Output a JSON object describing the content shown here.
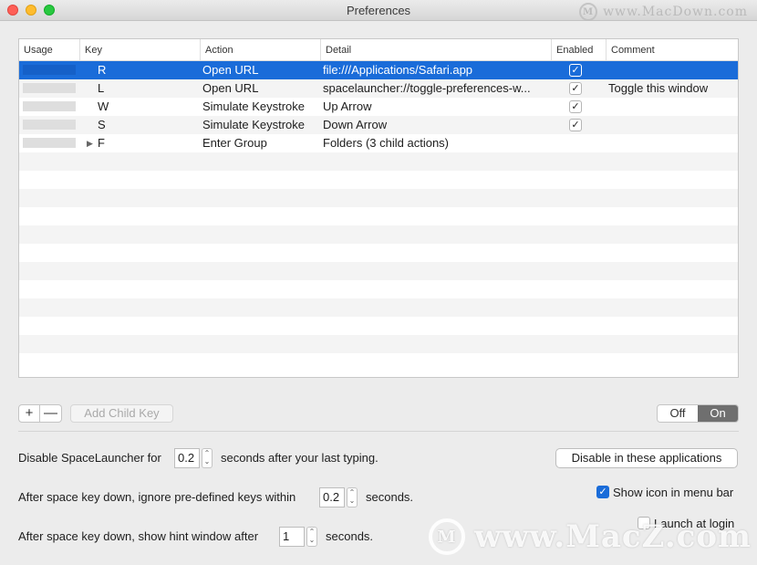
{
  "window": {
    "title": "Preferences",
    "watermark_top": "www.MacDown.com",
    "watermark_top_logo": "M",
    "watermark_bottom": "www.MacZ.com",
    "watermark_bottom_logo": "M"
  },
  "table": {
    "columns": [
      "Usage",
      "Key",
      "Action",
      "Detail",
      "Enabled",
      "Comment"
    ],
    "rows": [
      {
        "key": "R",
        "action": "Open URL",
        "detail": "file:///Applications/Safari.app",
        "enabled": true,
        "comment": "",
        "selected": true,
        "expandable": false
      },
      {
        "key": "L",
        "action": "Open URL",
        "detail": "spacelauncher://toggle-preferences-w...",
        "enabled": true,
        "comment": "Toggle this window",
        "selected": false,
        "expandable": false
      },
      {
        "key": "W",
        "action": "Simulate Keystroke",
        "detail": "Up Arrow",
        "enabled": true,
        "comment": "",
        "selected": false,
        "expandable": false
      },
      {
        "key": "S",
        "action": "Simulate Keystroke",
        "detail": "Down Arrow",
        "enabled": true,
        "comment": "",
        "selected": false,
        "expandable": false
      },
      {
        "key": "F",
        "action": "Enter Group",
        "detail": "Folders (3 child actions)",
        "enabled": null,
        "comment": "",
        "selected": false,
        "expandable": true
      }
    ]
  },
  "toolbar": {
    "add_symbol": "+",
    "remove_symbol": "—",
    "add_child_label": "Add Child Key",
    "off_label": "Off",
    "on_label": "On"
  },
  "settings": {
    "disable_prefix": "Disable SpaceLauncher for",
    "disable_value": "0.2",
    "disable_suffix": "seconds after your last typing.",
    "ignore_prefix": "After space key down, ignore pre-defined keys within",
    "ignore_value": "0.2",
    "ignore_suffix": "seconds.",
    "hint_prefix": "After space key down, show hint window after",
    "hint_value": "1",
    "hint_suffix": "seconds.",
    "disable_apps_label": "Disable in these applications",
    "show_icon_label": "Show icon in menu bar",
    "show_icon_checked": true,
    "launch_login_label": "Launch at login",
    "launch_login_checked": false
  },
  "icons": {
    "checkmark": "✓",
    "disclosure": "▶",
    "stepper_up": "⌃",
    "stepper_down": "⌄"
  }
}
